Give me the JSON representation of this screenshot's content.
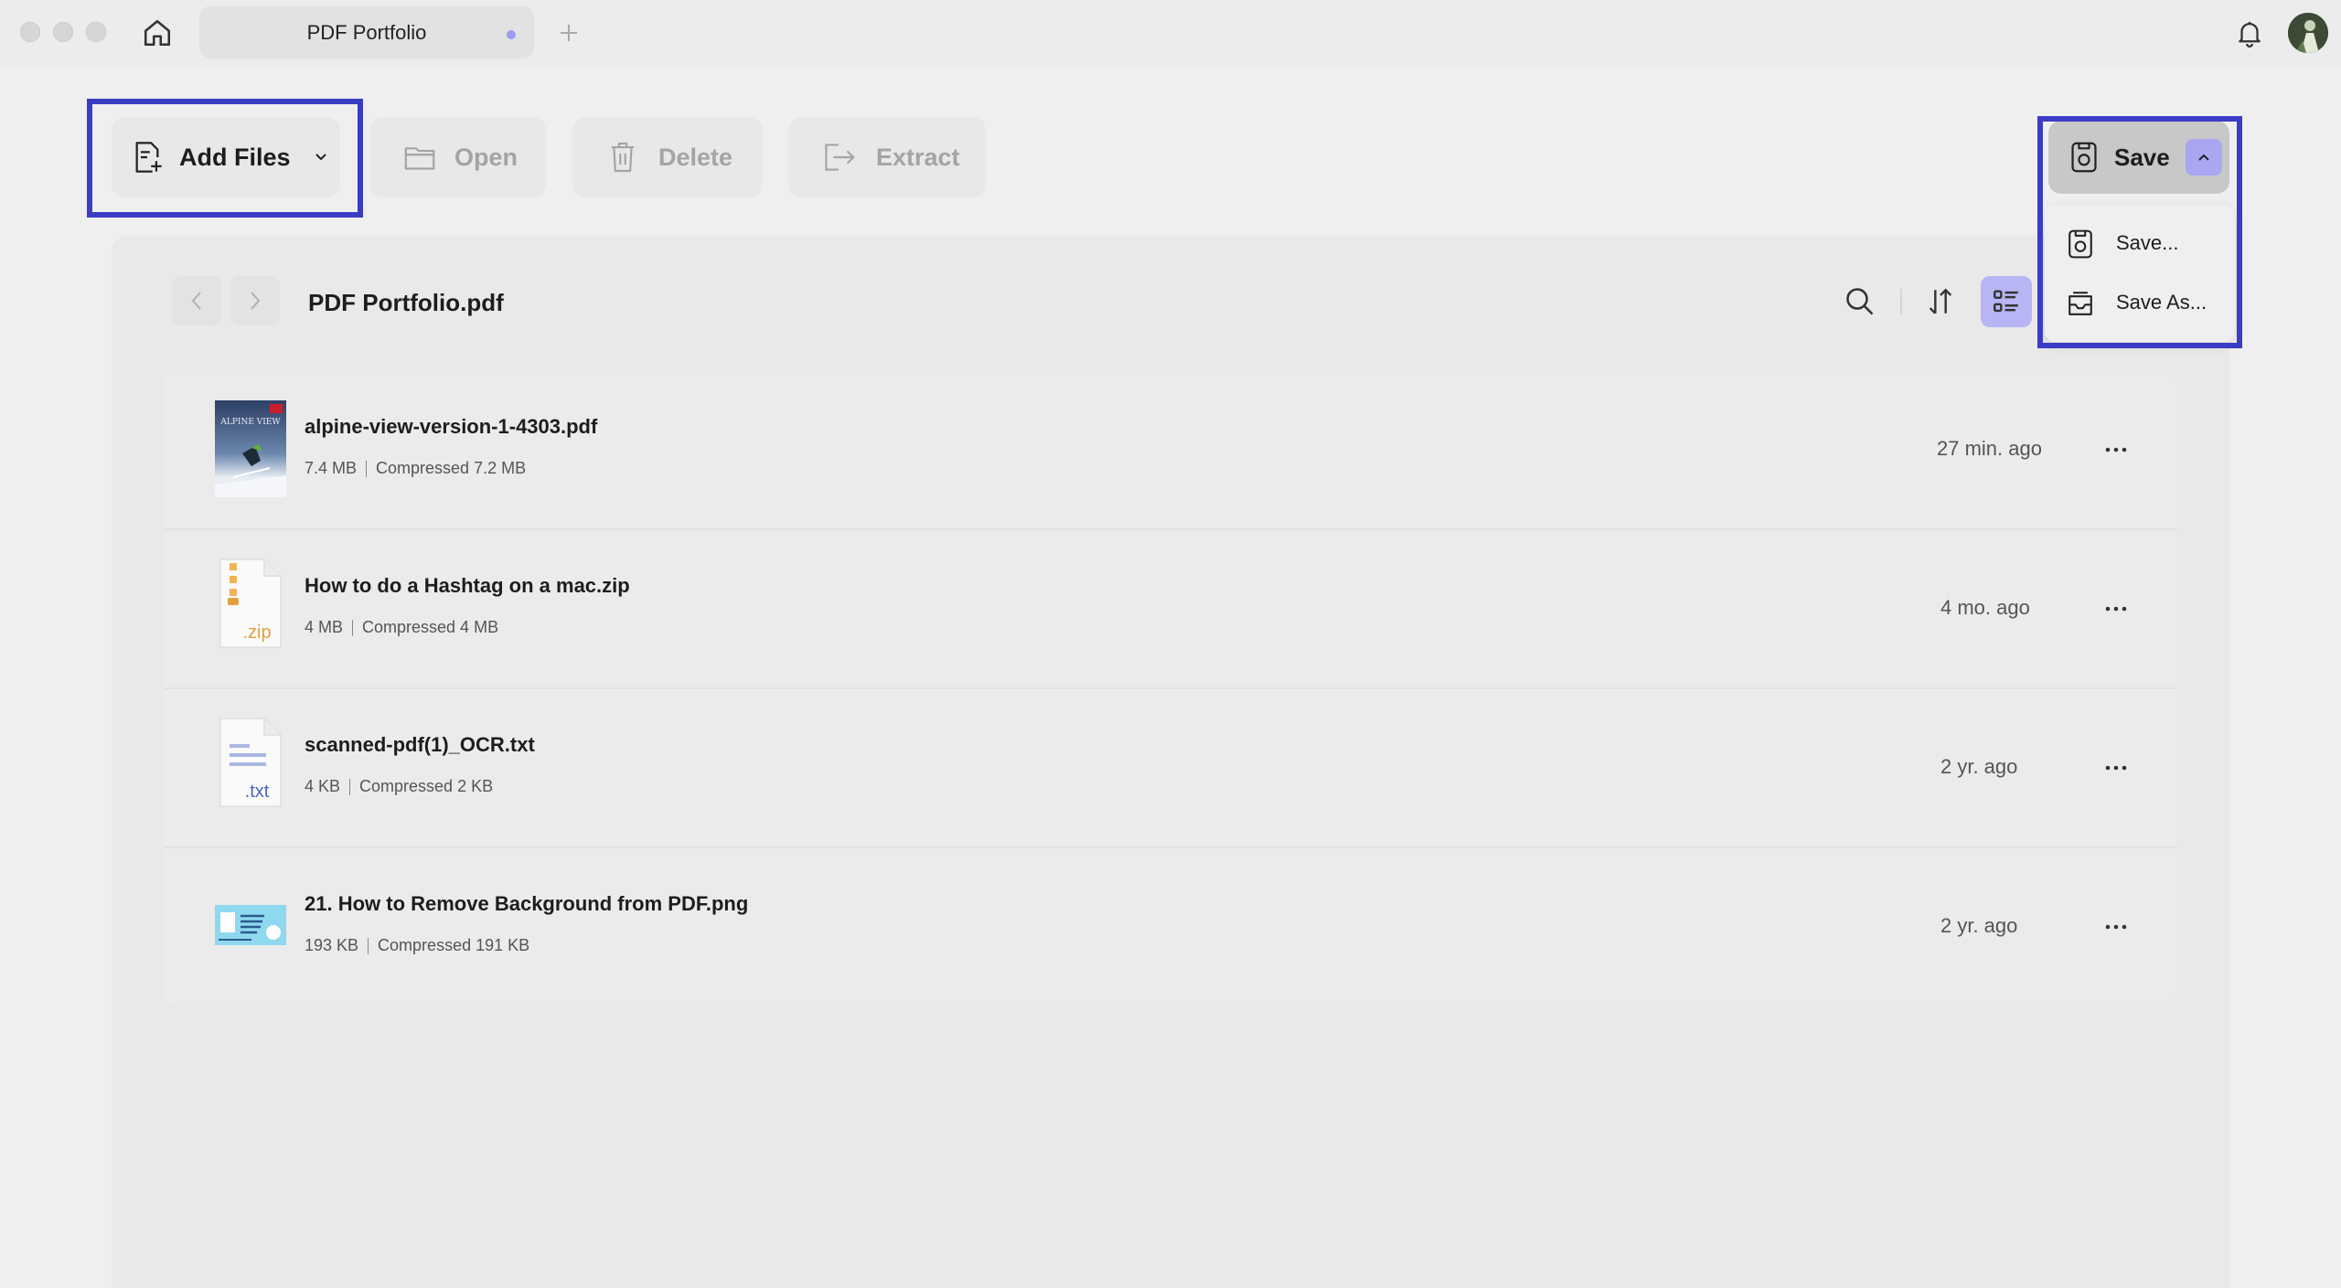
{
  "window": {
    "tab_title": "PDF Portfolio",
    "accent_color": "#3b3cc4",
    "tab_dot_color": "#9d9cf0"
  },
  "toolbar": {
    "add_files_label": "Add Files",
    "open_label": "Open",
    "delete_label": "Delete",
    "extract_label": "Extract",
    "save_label": "Save"
  },
  "save_menu": {
    "items": [
      {
        "label": "Save...",
        "icon": "save-icon"
      },
      {
        "label": "Save As...",
        "icon": "save-as-icon"
      }
    ]
  },
  "panel": {
    "title": "PDF Portfolio.pdf",
    "active_view": "list"
  },
  "files": [
    {
      "name": "alpine-view-version-1-4303.pdf",
      "size": "7.4 MB",
      "compressed": "Compressed 7.2 MB",
      "time": "27 min. ago",
      "thumb": "pdf-cover",
      "thumb_text": "ALPINE VIEW"
    },
    {
      "name": "How to do a Hashtag on a mac.zip",
      "size": "4 MB",
      "compressed": "Compressed 4 MB",
      "time": "4 mo. ago",
      "thumb": "zip-icon",
      "thumb_text": ".zip"
    },
    {
      "name": "scanned-pdf(1)_OCR.txt",
      "size": "4 KB",
      "compressed": "Compressed 2 KB",
      "time": "2 yr. ago",
      "thumb": "txt-icon",
      "thumb_text": ".txt"
    },
    {
      "name": "21. How to Remove Background from PDF.png",
      "size": "193 KB",
      "compressed": "Compressed 191 KB",
      "time": "2 yr. ago",
      "thumb": "png-preview"
    }
  ]
}
